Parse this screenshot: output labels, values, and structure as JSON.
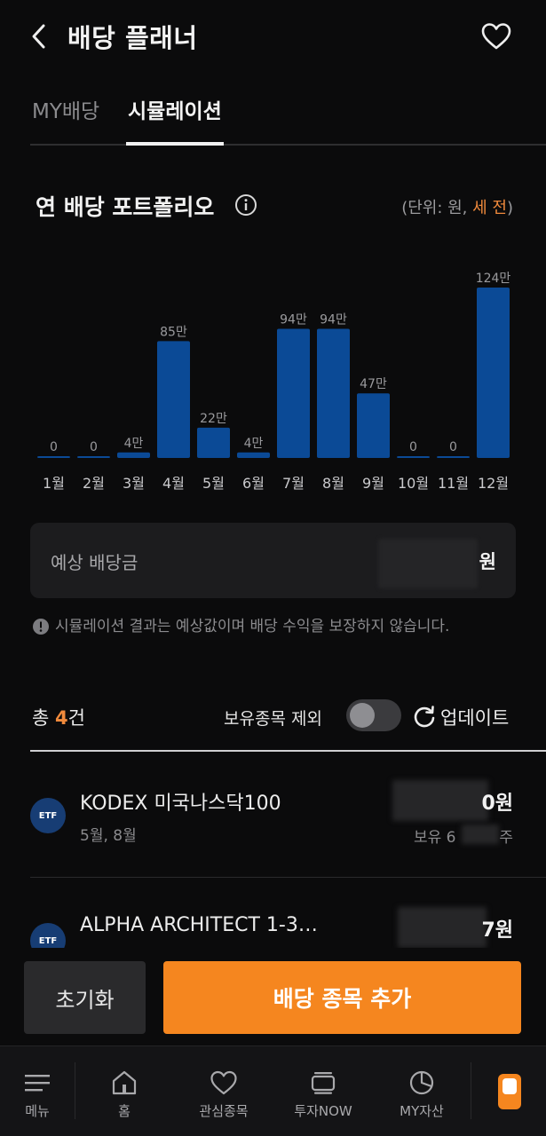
{
  "header": {
    "title": "배당 플래너"
  },
  "tabs": [
    {
      "label": "MY배당",
      "active": false
    },
    {
      "label": "시뮬레이션",
      "active": true
    }
  ],
  "portfolio": {
    "title": "연 배당 포트폴리오",
    "unit_prefix": "(단위: 원, ",
    "unit_tax": "세 전",
    "unit_suffix": ")"
  },
  "chart_data": {
    "type": "bar",
    "categories": [
      "1월",
      "2월",
      "3월",
      "4월",
      "5월",
      "6월",
      "7월",
      "8월",
      "9월",
      "10월",
      "11월",
      "12월"
    ],
    "values": [
      0,
      0,
      40000,
      850000,
      220000,
      40000,
      940000,
      940000,
      470000,
      0,
      0,
      1240000
    ],
    "data_labels": [
      "0",
      "0",
      "4만",
      "85만",
      "22만",
      "4만",
      "94만",
      "94만",
      "47만",
      "0",
      "0",
      "124만"
    ],
    "ylim": [
      0,
      1240000
    ],
    "grid": false,
    "bar_color": "#0b4a96"
  },
  "expected": {
    "label": "예상 배당금",
    "currency": "원"
  },
  "notice": "시뮬레이션 결과는 예상값이며 배당 수익을 보장하지 않습니다.",
  "list_header": {
    "total_prefix": "총 ",
    "total_count": "4",
    "total_suffix": "건",
    "exclude_label": "보유종목 제외",
    "exclude_on": false,
    "update_label": "업데이트"
  },
  "items": [
    {
      "badge": "ETF",
      "name": "KODEX 미국나스닥100",
      "months": "5월, 8월",
      "amount_suffix": "0원",
      "hold_prefix": "보유 6",
      "hold_suffix": "주"
    },
    {
      "badge": "ETF",
      "name": "ALPHA ARCHITECT 1-3…",
      "amount_suffix": "7원"
    }
  ],
  "actions": {
    "reset": "초기화",
    "add": "배당 종목 추가"
  },
  "nav": [
    {
      "label": "메뉴",
      "icon": "menu-icon"
    },
    {
      "label": "홈",
      "icon": "home-icon"
    },
    {
      "label": "관심종목",
      "icon": "heart-icon"
    },
    {
      "label": "투자NOW",
      "icon": "feed-icon"
    },
    {
      "label": "MY자산",
      "icon": "pie-chart-icon"
    }
  ],
  "colors": {
    "accent": "#f5861f",
    "bar": "#0b4a96",
    "background": "#0b0b0c"
  }
}
